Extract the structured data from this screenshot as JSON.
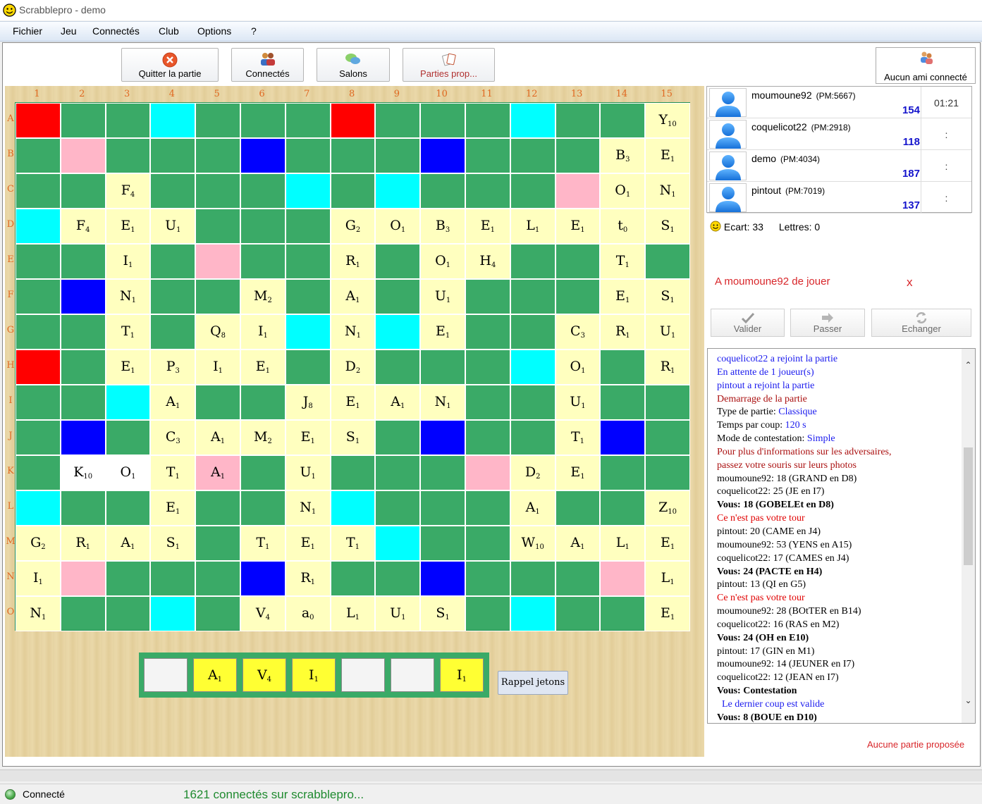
{
  "window": {
    "title": "Scrabblepro - demo"
  },
  "menu": [
    "Fichier",
    "Jeu",
    "Connectés",
    "Club",
    "Options",
    "?"
  ],
  "toolbar": {
    "quit_label": "Quitter la partie",
    "connected_label": "Connectés",
    "rooms_label": "Salons",
    "proposed_label": "Parties prop...",
    "friends_label": "Aucun ami connecté"
  },
  "board": {
    "columns": [
      "1",
      "2",
      "3",
      "4",
      "5",
      "6",
      "7",
      "8",
      "9",
      "10",
      "11",
      "12",
      "13",
      "14",
      "15"
    ],
    "rows": [
      "A",
      "B",
      "C",
      "D",
      "E",
      "F",
      "G",
      "H",
      "I",
      "J",
      "K",
      "L",
      "M",
      "N",
      "O"
    ],
    "tiles": [
      {
        "row": 0,
        "col": 14,
        "letter": "Y",
        "points": "10"
      },
      {
        "row": 1,
        "col": 13,
        "letter": "B",
        "points": "3"
      },
      {
        "row": 1,
        "col": 14,
        "letter": "E",
        "points": "1"
      },
      {
        "row": 2,
        "col": 2,
        "letter": "F",
        "points": "4"
      },
      {
        "row": 2,
        "col": 13,
        "letter": "O",
        "points": "1"
      },
      {
        "row": 2,
        "col": 14,
        "letter": "N",
        "points": "1"
      },
      {
        "row": 3,
        "col": 1,
        "letter": "F",
        "points": "4"
      },
      {
        "row": 3,
        "col": 2,
        "letter": "E",
        "points": "1"
      },
      {
        "row": 3,
        "col": 3,
        "letter": "U",
        "points": "1"
      },
      {
        "row": 3,
        "col": 7,
        "letter": "G",
        "points": "2"
      },
      {
        "row": 3,
        "col": 8,
        "letter": "O",
        "points": "1"
      },
      {
        "row": 3,
        "col": 9,
        "letter": "B",
        "points": "3"
      },
      {
        "row": 3,
        "col": 10,
        "letter": "E",
        "points": "1"
      },
      {
        "row": 3,
        "col": 11,
        "letter": "L",
        "points": "1"
      },
      {
        "row": 3,
        "col": 12,
        "letter": "E",
        "points": "1"
      },
      {
        "row": 3,
        "col": 13,
        "letter": "t",
        "points": "0"
      },
      {
        "row": 3,
        "col": 14,
        "letter": "S",
        "points": "1"
      },
      {
        "row": 4,
        "col": 2,
        "letter": "I",
        "points": "1"
      },
      {
        "row": 4,
        "col": 7,
        "letter": "R",
        "points": "1"
      },
      {
        "row": 4,
        "col": 9,
        "letter": "O",
        "points": "1"
      },
      {
        "row": 4,
        "col": 10,
        "letter": "H",
        "points": "4"
      },
      {
        "row": 4,
        "col": 13,
        "letter": "T",
        "points": "1"
      },
      {
        "row": 5,
        "col": 2,
        "letter": "N",
        "points": "1"
      },
      {
        "row": 5,
        "col": 5,
        "letter": "M",
        "points": "2"
      },
      {
        "row": 5,
        "col": 7,
        "letter": "A",
        "points": "1"
      },
      {
        "row": 5,
        "col": 9,
        "letter": "U",
        "points": "1"
      },
      {
        "row": 5,
        "col": 13,
        "letter": "E",
        "points": "1"
      },
      {
        "row": 5,
        "col": 14,
        "letter": "S",
        "points": "1"
      },
      {
        "row": 6,
        "col": 2,
        "letter": "T",
        "points": "1"
      },
      {
        "row": 6,
        "col": 4,
        "letter": "Q",
        "points": "8"
      },
      {
        "row": 6,
        "col": 5,
        "letter": "I",
        "points": "1"
      },
      {
        "row": 6,
        "col": 7,
        "letter": "N",
        "points": "1"
      },
      {
        "row": 6,
        "col": 9,
        "letter": "E",
        "points": "1"
      },
      {
        "row": 6,
        "col": 12,
        "letter": "C",
        "points": "3"
      },
      {
        "row": 6,
        "col": 13,
        "letter": "R",
        "points": "1"
      },
      {
        "row": 6,
        "col": 14,
        "letter": "U",
        "points": "1"
      },
      {
        "row": 7,
        "col": 2,
        "letter": "E",
        "points": "1"
      },
      {
        "row": 7,
        "col": 3,
        "letter": "P",
        "points": "3"
      },
      {
        "row": 7,
        "col": 4,
        "letter": "I",
        "points": "1"
      },
      {
        "row": 7,
        "col": 5,
        "letter": "E",
        "points": "1"
      },
      {
        "row": 7,
        "col": 7,
        "letter": "D",
        "points": "2"
      },
      {
        "row": 7,
        "col": 12,
        "letter": "O",
        "points": "1"
      },
      {
        "row": 7,
        "col": 14,
        "letter": "R",
        "points": "1"
      },
      {
        "row": 8,
        "col": 3,
        "letter": "A",
        "points": "1"
      },
      {
        "row": 8,
        "col": 6,
        "letter": "J",
        "points": "8"
      },
      {
        "row": 8,
        "col": 7,
        "letter": "E",
        "points": "1"
      },
      {
        "row": 8,
        "col": 8,
        "letter": "A",
        "points": "1"
      },
      {
        "row": 8,
        "col": 9,
        "letter": "N",
        "points": "1"
      },
      {
        "row": 8,
        "col": 12,
        "letter": "U",
        "points": "1"
      },
      {
        "row": 9,
        "col": 3,
        "letter": "C",
        "points": "3"
      },
      {
        "row": 9,
        "col": 4,
        "letter": "A",
        "points": "1"
      },
      {
        "row": 9,
        "col": 5,
        "letter": "M",
        "points": "2"
      },
      {
        "row": 9,
        "col": 6,
        "letter": "E",
        "points": "1"
      },
      {
        "row": 9,
        "col": 7,
        "letter": "S",
        "points": "1"
      },
      {
        "row": 9,
        "col": 12,
        "letter": "T",
        "points": "1"
      },
      {
        "row": 10,
        "col": 1,
        "letter": "K",
        "points": "10",
        "new": true
      },
      {
        "row": 10,
        "col": 2,
        "letter": "O",
        "points": "1",
        "new": true
      },
      {
        "row": 10,
        "col": 3,
        "letter": "T",
        "points": "1"
      },
      {
        "row": 10,
        "col": 4,
        "letter": "A",
        "points": "1",
        "bg": "dw"
      },
      {
        "row": 10,
        "col": 6,
        "letter": "U",
        "points": "1"
      },
      {
        "row": 10,
        "col": 11,
        "letter": "D",
        "points": "2"
      },
      {
        "row": 10,
        "col": 12,
        "letter": "E",
        "points": "1"
      },
      {
        "row": 11,
        "col": 3,
        "letter": "E",
        "points": "1"
      },
      {
        "row": 11,
        "col": 6,
        "letter": "N",
        "points": "1"
      },
      {
        "row": 11,
        "col": 11,
        "letter": "A",
        "points": "1"
      },
      {
        "row": 11,
        "col": 14,
        "letter": "Z",
        "points": "10"
      },
      {
        "row": 12,
        "col": 0,
        "letter": "G",
        "points": "2"
      },
      {
        "row": 12,
        "col": 1,
        "letter": "R",
        "points": "1"
      },
      {
        "row": 12,
        "col": 2,
        "letter": "A",
        "points": "1"
      },
      {
        "row": 12,
        "col": 3,
        "letter": "S",
        "points": "1"
      },
      {
        "row": 12,
        "col": 5,
        "letter": "T",
        "points": "1"
      },
      {
        "row": 12,
        "col": 6,
        "letter": "E",
        "points": "1"
      },
      {
        "row": 12,
        "col": 7,
        "letter": "T",
        "points": "1"
      },
      {
        "row": 12,
        "col": 11,
        "letter": "W",
        "points": "10"
      },
      {
        "row": 12,
        "col": 12,
        "letter": "A",
        "points": "1"
      },
      {
        "row": 12,
        "col": 13,
        "letter": "L",
        "points": "1"
      },
      {
        "row": 12,
        "col": 14,
        "letter": "E",
        "points": "1"
      },
      {
        "row": 13,
        "col": 0,
        "letter": "I",
        "points": "1"
      },
      {
        "row": 13,
        "col": 6,
        "letter": "R",
        "points": "1"
      },
      {
        "row": 13,
        "col": 14,
        "letter": "L",
        "points": "1"
      },
      {
        "row": 14,
        "col": 0,
        "letter": "N",
        "points": "1"
      },
      {
        "row": 14,
        "col": 5,
        "letter": "V",
        "points": "4"
      },
      {
        "row": 14,
        "col": 6,
        "letter": "a",
        "points": "0"
      },
      {
        "row": 14,
        "col": 7,
        "letter": "L",
        "points": "1"
      },
      {
        "row": 14,
        "col": 8,
        "letter": "U",
        "points": "1"
      },
      {
        "row": 14,
        "col": 9,
        "letter": "S",
        "points": "1"
      },
      {
        "row": 14,
        "col": 14,
        "letter": "E",
        "points": "1"
      }
    ],
    "premium": [
      {
        "row": 0,
        "col": 0,
        "type": "tw"
      },
      {
        "row": 0,
        "col": 7,
        "type": "tw"
      },
      {
        "row": 7,
        "col": 0,
        "type": "tw"
      },
      {
        "row": 0,
        "col": 3,
        "type": "dl"
      },
      {
        "row": 0,
        "col": 11,
        "type": "dl"
      },
      {
        "row": 1,
        "col": 1,
        "type": "dw"
      },
      {
        "row": 1,
        "col": 5,
        "type": "tl"
      },
      {
        "row": 1,
        "col": 9,
        "type": "tl"
      },
      {
        "row": 2,
        "col": 6,
        "type": "dl"
      },
      {
        "row": 2,
        "col": 8,
        "type": "dl"
      },
      {
        "row": 2,
        "col": 12,
        "type": "dw"
      },
      {
        "row": 3,
        "col": 0,
        "type": "dl"
      },
      {
        "row": 4,
        "col": 4,
        "type": "dw"
      },
      {
        "row": 5,
        "col": 1,
        "type": "tl"
      },
      {
        "row": 6,
        "col": 6,
        "type": "dl"
      },
      {
        "row": 6,
        "col": 8,
        "type": "dl"
      },
      {
        "row": 7,
        "col": 11,
        "type": "dl"
      },
      {
        "row": 8,
        "col": 2,
        "type": "dl"
      },
      {
        "row": 9,
        "col": 1,
        "type": "tl"
      },
      {
        "row": 9,
        "col": 9,
        "type": "tl"
      },
      {
        "row": 9,
        "col": 13,
        "type": "tl"
      },
      {
        "row": 10,
        "col": 10,
        "type": "dw"
      },
      {
        "row": 11,
        "col": 0,
        "type": "dl"
      },
      {
        "row": 11,
        "col": 7,
        "type": "dl"
      },
      {
        "row": 12,
        "col": 8,
        "type": "dl"
      },
      {
        "row": 13,
        "col": 1,
        "type": "dw"
      },
      {
        "row": 13,
        "col": 5,
        "type": "tl"
      },
      {
        "row": 13,
        "col": 9,
        "type": "tl"
      },
      {
        "row": 13,
        "col": 13,
        "type": "dw"
      },
      {
        "row": 14,
        "col": 3,
        "type": "dl"
      },
      {
        "row": 14,
        "col": 11,
        "type": "dl"
      }
    ]
  },
  "rack": {
    "tiles": [
      {
        "letter": "",
        "points": ""
      },
      {
        "letter": "A",
        "points": "1"
      },
      {
        "letter": "V",
        "points": "4"
      },
      {
        "letter": "I",
        "points": "1"
      },
      {
        "letter": "",
        "points": ""
      },
      {
        "letter": "",
        "points": ""
      },
      {
        "letter": "I",
        "points": "1"
      }
    ],
    "recall_label": "Rappel jetons"
  },
  "players": [
    {
      "name": "moumoune92",
      "pm": "(PM:5667)",
      "score": "154",
      "time": "01:21"
    },
    {
      "name": "coquelicot22",
      "pm": "(PM:2918)",
      "score": "118",
      "time": ":"
    },
    {
      "name": "demo",
      "pm": "(PM:4034)",
      "score": "187",
      "time": ":"
    },
    {
      "name": "pintout",
      "pm": "(PM:7019)",
      "score": "137",
      "time": ":"
    }
  ],
  "stats": {
    "ecart": "Ecart: 33",
    "lettres": "Lettres: 0"
  },
  "turn": {
    "text": "A moumoune92 de jouer",
    "close": "x"
  },
  "actions": {
    "validate": "Valider",
    "pass": "Passer",
    "exchange": "Echanger"
  },
  "log": [
    {
      "text": "coquelicot22 a rejoint la partie",
      "style": "blue"
    },
    {
      "text": "En attente de 1 joueur(s)",
      "style": "blue"
    },
    {
      "text": "pintout a rejoint la partie",
      "style": "blue"
    },
    {
      "text": "Demarrage de la partie",
      "style": "dred"
    },
    {
      "text": "Type de partie: ",
      "value": "Classique",
      "style": "plain"
    },
    {
      "text": "Temps par coup: ",
      "value": "120 s",
      "style": "plain"
    },
    {
      "text": "Mode de contestation: ",
      "value": "Simple",
      "style": "plain"
    },
    {
      "text": "Pour plus d'informations sur les adversaires,",
      "style": "dred"
    },
    {
      "text": "passez votre souris sur leurs photos",
      "style": "dred"
    },
    {
      "text": "moumoune92: 18 (GRAND en D8)",
      "style": "plain"
    },
    {
      "text": "coquelicot22: 25 (JE en I7)",
      "style": "plain"
    },
    {
      "text": "Vous: 18 (GOBELEt en D8)",
      "style": "bold"
    },
    {
      "text": "Ce n'est pas votre tour",
      "style": "red"
    },
    {
      "text": "pintout: 20 (CAME en J4)",
      "style": "plain"
    },
    {
      "text": "moumoune92: 53 (YENS en A15)",
      "style": "plain"
    },
    {
      "text": "coquelicot22: 17 (CAMES en J4)",
      "style": "plain"
    },
    {
      "text": "Vous: 24 (PACTE en H4)",
      "style": "bold"
    },
    {
      "text": "pintout: 13 (QI en G5)",
      "style": "plain"
    },
    {
      "text": "Ce n'est pas votre tour",
      "style": "red"
    },
    {
      "text": "moumoune92: 28 (BOtTER en B14)",
      "style": "plain"
    },
    {
      "text": "coquelicot22: 16 (RAS en M2)",
      "style": "plain"
    },
    {
      "text": "Vous: 24 (OH en E10)",
      "style": "bold"
    },
    {
      "text": "pintout: 17 (GIN en M1)",
      "style": "plain"
    },
    {
      "text": "moumoune92: 14 (JEUNER en I7)",
      "style": "plain"
    },
    {
      "text": "coquelicot22: 12 (JEAN en I7)",
      "style": "plain"
    },
    {
      "text": "Vous: Contestation",
      "style": "bold"
    },
    {
      "text": "Le dernier coup est valide",
      "style": "blue-indent"
    },
    {
      "text": "Vous: 8 (BOUE en D10)",
      "style": "bold"
    }
  ],
  "no_game": "Aucune partie proposée",
  "status": {
    "state": "Connecté",
    "count": "1621 connectés sur scrabblepro..."
  },
  "colors": {
    "board_green": "#3aaa67",
    "tile": "#ffffbf",
    "triple_word": "#ff0000",
    "double_word": "#ffb6c8",
    "triple_letter": "#0000ff",
    "double_letter": "#00ffff",
    "rack_tile": "#ffff33",
    "label_orange": "#e06820",
    "score_blue": "#1414cc",
    "turn_red": "#d8262a"
  }
}
